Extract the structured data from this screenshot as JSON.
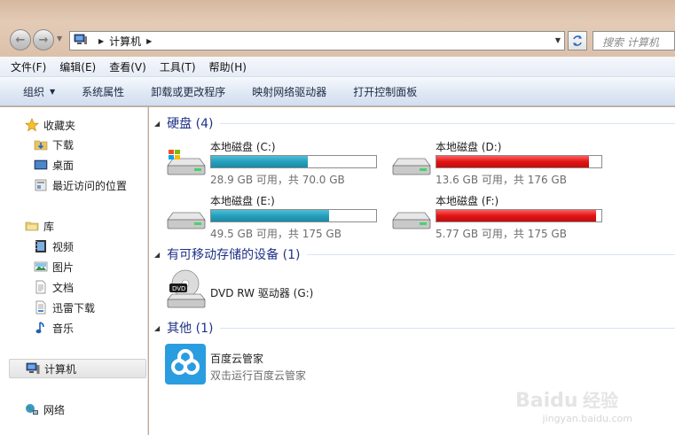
{
  "address": {
    "location": "计算机",
    "search_placeholder": "搜索 计算机"
  },
  "menubar": [
    {
      "label": "文件(F)"
    },
    {
      "label": "编辑(E)"
    },
    {
      "label": "查看(V)"
    },
    {
      "label": "工具(T)"
    },
    {
      "label": "帮助(H)"
    }
  ],
  "commandbar": {
    "organize": "组织",
    "items": [
      {
        "label": "系统属性"
      },
      {
        "label": "卸载或更改程序"
      },
      {
        "label": "映射网络驱动器"
      },
      {
        "label": "打开控制面板"
      }
    ]
  },
  "sidebar": {
    "favorites": {
      "label": "收藏夹",
      "icon": "star-icon"
    },
    "favorites_items": [
      {
        "label": "下载",
        "icon": "download-folder-icon"
      },
      {
        "label": "桌面",
        "icon": "desktop-icon"
      },
      {
        "label": "最近访问的位置",
        "icon": "recent-places-icon"
      }
    ],
    "libraries": {
      "label": "库",
      "icon": "library-icon"
    },
    "library_items": [
      {
        "label": "视频",
        "icon": "video-icon"
      },
      {
        "label": "图片",
        "icon": "pictures-icon"
      },
      {
        "label": "文档",
        "icon": "documents-icon"
      },
      {
        "label": "迅雷下载",
        "icon": "thunder-download-icon"
      },
      {
        "label": "音乐",
        "icon": "music-icon"
      }
    ],
    "computer": {
      "label": "计算机",
      "icon": "computer-icon"
    },
    "network": {
      "label": "网络",
      "icon": "network-icon"
    }
  },
  "sections": {
    "hard_drives": "硬盘 (4)",
    "removable": "有可移动存储的设备 (1)",
    "other": "其他 (1)"
  },
  "drives": [
    {
      "name": "本地磁盘 (C:)",
      "info": "28.9 GB 可用，共 70.0 GB",
      "used_fraction": 0.587,
      "bar_color": "#26a0bd"
    },
    {
      "name": "本地磁盘 (D:)",
      "info": "13.6 GB 可用，共 176 GB",
      "used_fraction": 0.923,
      "bar_color": "#e01414"
    },
    {
      "name": "本地磁盘 (E:)",
      "info": "49.5 GB 可用，共 175 GB",
      "used_fraction": 0.717,
      "bar_color": "#26a0bd"
    },
    {
      "name": "本地磁盘 (F:)",
      "info": "5.77 GB 可用，共 175 GB",
      "used_fraction": 0.967,
      "bar_color": "#e01414"
    }
  ],
  "removable_devices": [
    {
      "name": "DVD RW 驱动器 (G:)",
      "icon": "dvd-drive-icon"
    }
  ],
  "other_items": [
    {
      "name": "百度云管家",
      "subtitle": "双击运行百度云管家",
      "icon": "baidu-cloud-icon"
    }
  ],
  "watermark": {
    "brand": "Baidu 经验",
    "url": "jingyan.baidu.com"
  }
}
